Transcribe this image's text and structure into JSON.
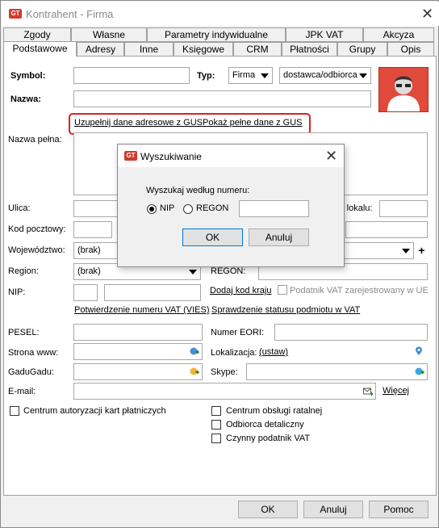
{
  "window": {
    "title": "Kontrahent - Firma",
    "icon_text": "GT"
  },
  "tabs_row1": [
    "Zgody",
    "Własne",
    "Parametry indywidualne",
    "JPK VAT",
    "Akcyza"
  ],
  "tabs_row2": [
    "Podstawowe",
    "Adresy",
    "Inne",
    "Księgowe",
    "CRM",
    "Płatności",
    "Grupy",
    "Opis"
  ],
  "form": {
    "symbol_label": "Symbol:",
    "typ_label": "Typ:",
    "typ_value": "Firma",
    "typ2_value": "dostawca/odbiorca",
    "nazwa_label": "Nazwa:",
    "gus_fill_link": "Uzupełnij dane adresowe z GUS",
    "gus_show_link": "Pokaż pełne dane z GUS",
    "nazwa_pelna_label": "Nazwa pełna:",
    "ulica_label": "Ulica:",
    "nr_lokalu_label": "Nr lokalu:",
    "kod_label": "Kod pocztowy:",
    "wojewodztwo_label": "Województwo:",
    "wojewodztwo_value": "(brak)",
    "region_label": "Region:",
    "region_value": "(brak)",
    "regon_label": "REGON:",
    "nip_label": "NIP:",
    "dodaj_kod_link": "Dodaj kod kraju",
    "podatnik_ue_label": "Podatnik VAT zarejestrowany w UE",
    "vies_link": "Potwierdzenie numeru VAT (VIES)",
    "status_vat_link": "Sprawdzenie statusu podmiotu w VAT",
    "pesel_label": "PESEL:",
    "eori_label": "Numer EORI:",
    "www_label": "Strona www:",
    "lokalizacja_label": "Lokalizacja:",
    "ustaw_link": "(ustaw)",
    "gadugadu_label": "GaduGadu:",
    "skype_label": "Skype:",
    "email_label": "E-mail:",
    "wiecej_link": "Więcej",
    "plus_label": "+",
    "checkboxes": [
      "Centrum autoryzacji kart płatniczych",
      "Centrum obsługi ratalnej",
      "Odbiorca detaliczny",
      "Czynny podatnik VAT"
    ]
  },
  "buttons": {
    "ok": "OK",
    "cancel": "Anuluj",
    "help": "Pomoc"
  },
  "dialog": {
    "title": "Wyszukiwanie",
    "prompt": "Wyszukaj według numeru:",
    "radio_nip": "NIP",
    "radio_regon": "REGON",
    "ok": "OK",
    "cancel": "Anuluj"
  },
  "colors": {
    "accent": "#0078d7",
    "highlight": "#e02020",
    "avatar_bg": "#e04a3a"
  }
}
